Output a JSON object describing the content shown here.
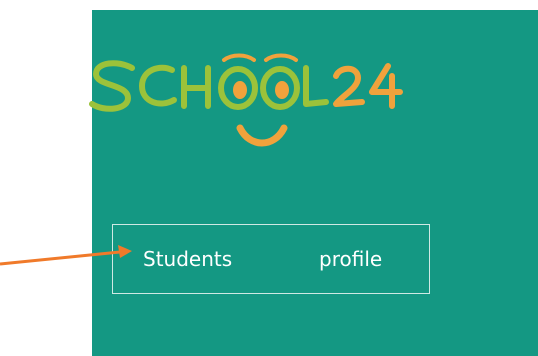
{
  "logo": {
    "text_main": "SCHOOL",
    "text_num": "24",
    "colors": {
      "letters": "#9cc23a",
      "accent": "#f0a23c"
    }
  },
  "students_button": {
    "word1": "Students",
    "word2": "profile"
  },
  "colors": {
    "panel": "#149883",
    "arrow": "#f07a2a",
    "border": "#cfe9e4"
  }
}
